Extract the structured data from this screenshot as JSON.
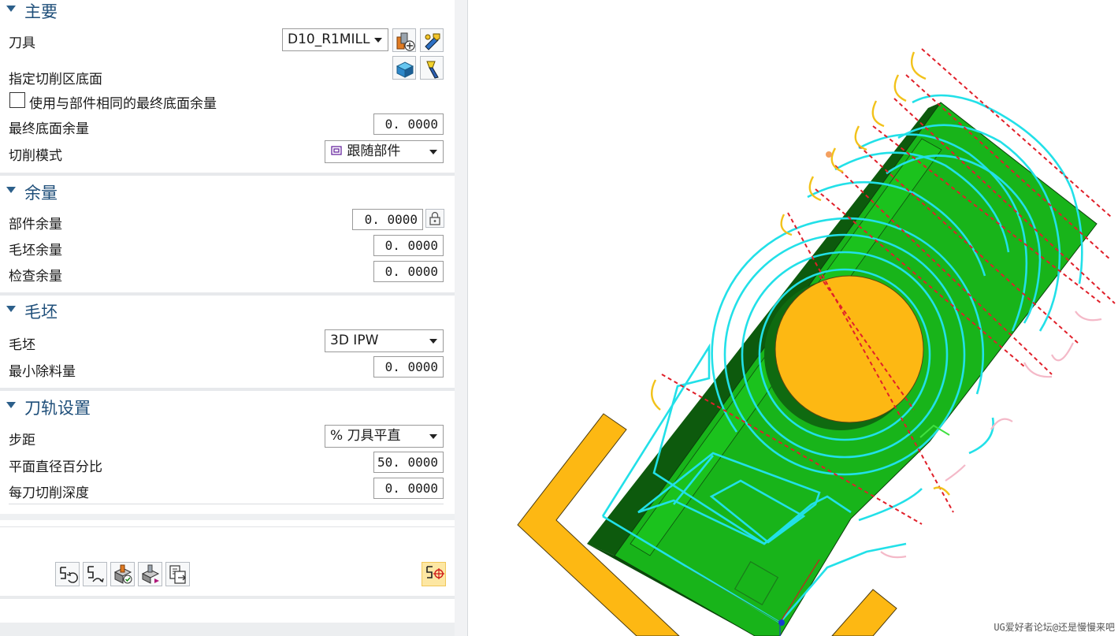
{
  "sections": {
    "main": {
      "title": "主要",
      "tool_label": "刀具",
      "tool_value": "D10_R1MILL",
      "floor_label": "指定切削区底面",
      "same_floor_checkbox_label": "使用与部件相同的最终底面余量",
      "same_floor_checked": false,
      "final_floor_stock_label": "最终底面余量",
      "final_floor_stock_value": "0. 0000",
      "cut_pattern_label": "切削模式",
      "cut_pattern_value": "跟随部件"
    },
    "stock": {
      "title": "余量",
      "part_stock_label": "部件余量",
      "part_stock_value": "0. 0000",
      "blank_stock_label": "毛坯余量",
      "blank_stock_value": "0. 0000",
      "check_stock_label": "检查余量",
      "check_stock_value": "0. 0000"
    },
    "blank": {
      "title": "毛坯",
      "blank_label": "毛坯",
      "blank_value": "3D IPW",
      "min_removal_label": "最小除料量",
      "min_removal_value": "0. 0000"
    },
    "path_settings": {
      "title": "刀轨设置",
      "stepover_label": "步距",
      "stepover_value": "% 刀具平直",
      "percent_flat_label": "平面直径百分比",
      "percent_flat_value": "50. 0000",
      "depth_per_cut_label": "每刀切削深度",
      "depth_per_cut_value": "0. 0000"
    }
  },
  "icons": {
    "tool_new": "new-tool-icon",
    "tool_edit": "edit-tool-icon",
    "floor_select": "select-floor-icon",
    "floor_display": "flashlight-display-icon",
    "lock": "lock-icon",
    "generate": "generate-path-icon",
    "replay": "replay-path-icon",
    "verify": "verify-path-icon",
    "list": "list-path-icon",
    "export": "export-path-icon",
    "active": "active-toolpath-icon"
  },
  "viewport": {
    "watermark": "UG爱好者论坛@还是慢慢来吧"
  },
  "colors": {
    "part_green": "#18b41a",
    "boss_orange": "#fdb813",
    "toolpath_cyan": "#22e0e8",
    "rapid_red": "#e0202a",
    "section_title": "#1f4f7a"
  }
}
